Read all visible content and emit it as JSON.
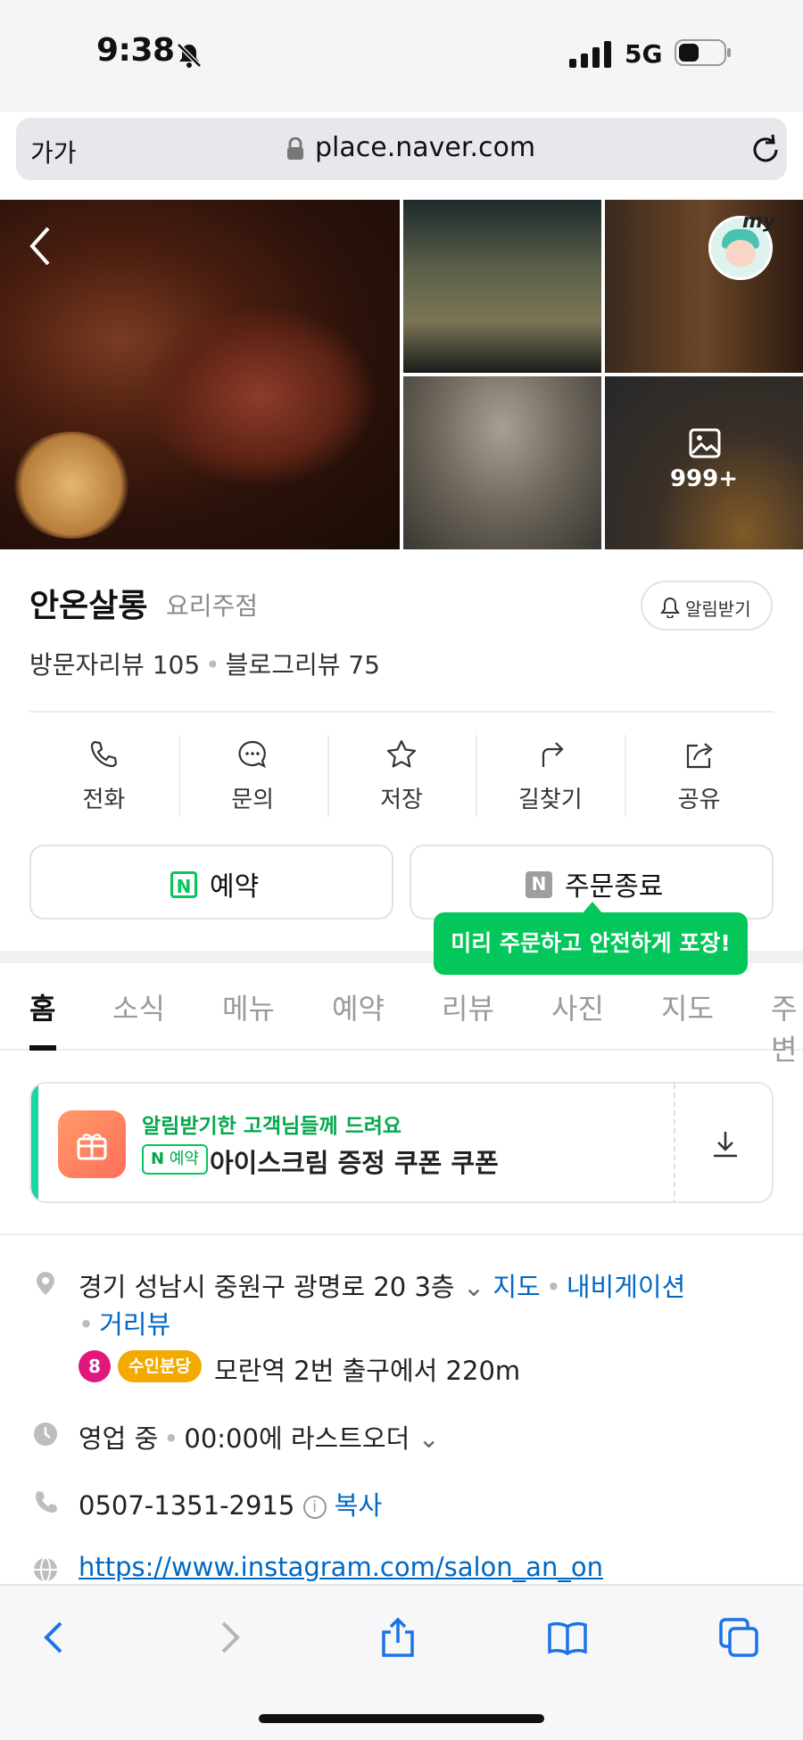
{
  "status": {
    "time": "9:38",
    "network": "5G"
  },
  "browser": {
    "text_size_label": "가가",
    "url": "place.naver.com"
  },
  "photos": {
    "more_count": "999+",
    "avatar_label": "my"
  },
  "place": {
    "name": "안온살롱",
    "category": "요리주점",
    "alarm_label": "알림받기",
    "visitor_reviews": "방문자리뷰 105",
    "blog_reviews": "블로그리뷰 75"
  },
  "actions": [
    {
      "label": "전화",
      "icon": "phone-icon"
    },
    {
      "label": "문의",
      "icon": "chat-icon"
    },
    {
      "label": "저장",
      "icon": "star-icon"
    },
    {
      "label": "길찾기",
      "icon": "directions-icon"
    },
    {
      "label": "공유",
      "icon": "share-icon"
    }
  ],
  "buttons": {
    "reserve": "예약",
    "order": "주문종료",
    "n_mark": "N"
  },
  "tooltip": "미리 주문하고 안전하게 포장!",
  "tabs": [
    "홈",
    "소식",
    "메뉴",
    "예약",
    "리뷰",
    "사진",
    "지도",
    "주변"
  ],
  "coupon": {
    "top_text": "알림받기한 고객님들께 드려요",
    "badge_n": "N",
    "badge_text": "예약",
    "title": "아이스크림 증정 쿠폰 쿠폰"
  },
  "info": {
    "address": "경기 성남시 중원구 광명로 20 3층",
    "map_link": "지도",
    "nav_link": "내비게이션",
    "street_link": "거리뷰",
    "subway_number": "8",
    "subway_line": "수인분당",
    "subway_text": "모란역 2번 출구에서 220m",
    "hours_status": "영업 중",
    "hours_text": "00:00에 라스트오더",
    "phone": "0507-1351-2915",
    "copy_link": "복사",
    "website": "https://www.instagram.com/salon_an_on"
  },
  "colors": {
    "naver_green": "#03c75a",
    "link_blue": "#0068c3",
    "subway_line8": "#e0177c",
    "subway_suin": "#f2a900"
  }
}
